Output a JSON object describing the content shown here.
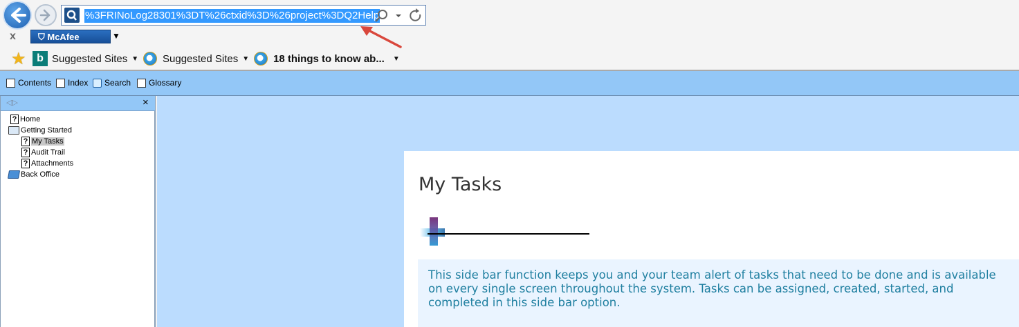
{
  "browser": {
    "address_url": "%3FRINoLog28301%3DT%26ctxid%3D%26project%3DQ2Help",
    "mcafee_label": "McAfee",
    "close_label": "x",
    "favorites": [
      {
        "label": "Suggested Sites",
        "icon": "bing-icon"
      },
      {
        "label": "Suggested Sites",
        "icon": "ie-icon"
      },
      {
        "label": "18 things to know ab...",
        "icon": "ie-icon"
      }
    ]
  },
  "help_toolbar": {
    "contents": "Contents",
    "index": "Index",
    "search": "Search",
    "glossary": "Glossary"
  },
  "left_pane": {
    "close_label": "×",
    "tree": [
      {
        "label": "Home",
        "icon": "help-page-icon",
        "level": 0
      },
      {
        "label": "Getting Started",
        "icon": "open-book-icon",
        "level": 0
      },
      {
        "label": "My Tasks",
        "icon": "help-page-icon",
        "level": 1,
        "selected": true
      },
      {
        "label": "Audit Trail",
        "icon": "help-page-icon",
        "level": 1
      },
      {
        "label": "Attachments",
        "icon": "help-page-icon",
        "level": 1
      },
      {
        "label": "Back Office",
        "icon": "closed-book-icon",
        "level": 0
      }
    ]
  },
  "content": {
    "title": "My Tasks",
    "description": "This side bar function keeps you and your team alert of tasks that need to be done and is available on every single screen throughout the system. Tasks can be assigned, created, started, and completed in this side bar option."
  },
  "colors": {
    "toolbar_bg": "#93c7f7",
    "content_bg": "#bbdcfe",
    "desc_text": "#1f7fa0",
    "url_highlight": "#3399ff",
    "annotation_arrow": "#d9473c"
  }
}
